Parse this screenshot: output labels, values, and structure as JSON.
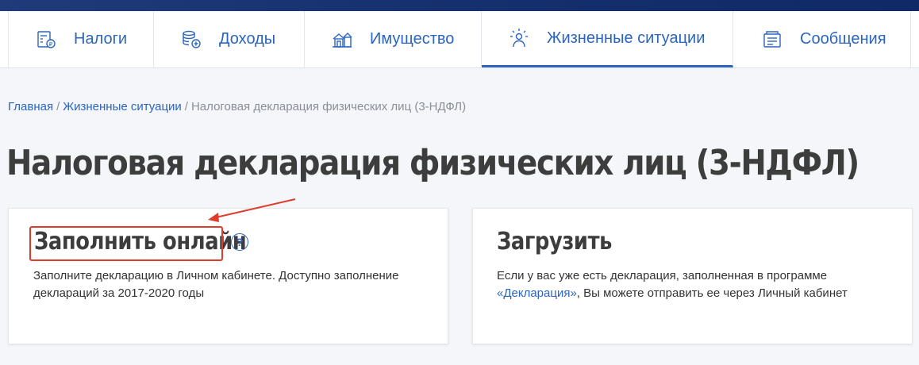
{
  "nav": {
    "items": [
      {
        "label": "Налоги",
        "icon": "tax-calculator-icon"
      },
      {
        "label": "Доходы",
        "icon": "coins-icon"
      },
      {
        "label": "Имущество",
        "icon": "property-icon"
      },
      {
        "label": "Жизненные ситуации",
        "icon": "people-situations-icon",
        "active": true
      },
      {
        "label": "Сообщения",
        "icon": "messages-icon"
      }
    ]
  },
  "breadcrumb": {
    "home": "Главная",
    "sep1": "/",
    "section": "Жизненные ситуации",
    "sep2": "/",
    "current": "Налоговая декларация физических лиц (3-НДФЛ)"
  },
  "page_title": "Налоговая декларация физических лиц (3-НДФЛ)",
  "cards": {
    "online": {
      "title": "Заполнить онлайн",
      "help": "?",
      "text": "Заполните декларацию в Личном кабинете. Доступно заполнение деклараций за 2017-2020 годы"
    },
    "upload": {
      "title": "Загрузить",
      "text_before": "Если у вас уже есть декларация, заполненная в программе ",
      "link": "«Декларация»",
      "text_after": ", Вы можете отправить ее через Личный кабинет"
    }
  },
  "colors": {
    "accent": "#2b65c0",
    "highlight": "#e03c2e",
    "top_bar": "#15306e"
  }
}
